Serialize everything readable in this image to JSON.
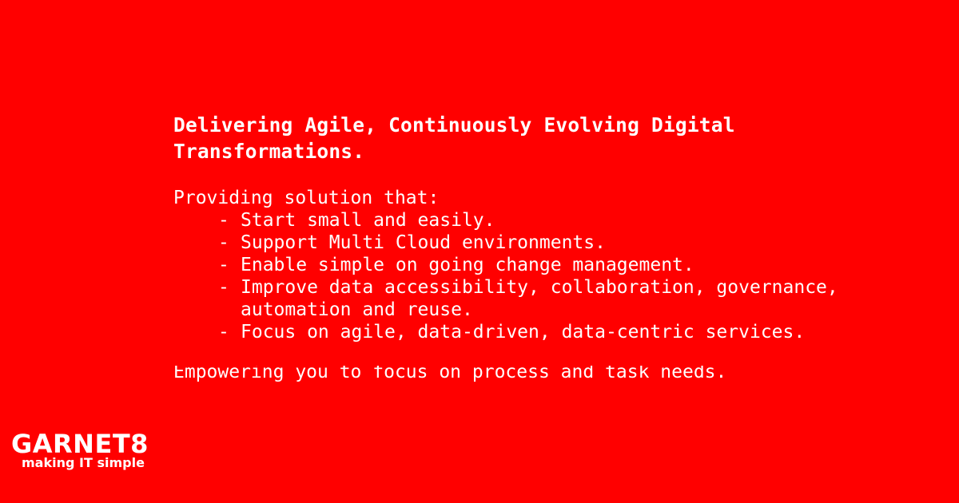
{
  "colors": {
    "background": "#ff0000",
    "text": "#ffffff"
  },
  "content": {
    "headline": "Delivering Agile, Continuously Evolving Digital Transformations.",
    "intro": "Providing solution that:",
    "points": [
      "Start small and easily.",
      "Support Multi Cloud environments.",
      "Enable simple on going change management.",
      "Improve data accessibility, collaboration, governance, automation and reuse.",
      "Focus on agile, data-driven, data-centric services."
    ],
    "bullet_marker": "-",
    "closing": "Empowering you to focus on process and task needs."
  },
  "logo": {
    "name": "GARNET8",
    "tagline": "making IT simple"
  }
}
